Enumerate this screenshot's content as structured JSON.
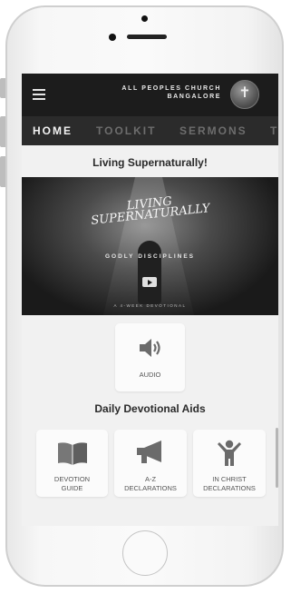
{
  "app": {
    "brand_line1": "ALL PEOPLES CHURCH",
    "brand_line2": "BANGALORE",
    "logo_label": "APC logo"
  },
  "tabs": [
    {
      "label": "HOME",
      "active": true
    },
    {
      "label": "TOOLKIT",
      "active": false
    },
    {
      "label": "SERMONS",
      "active": false
    },
    {
      "label": "T",
      "active": false
    }
  ],
  "home": {
    "title": "Living Supernaturally!",
    "hero": {
      "script_line1": "LIVING",
      "script_line2": "SUPERNATURALLY",
      "subtitle": "GODLY DISCIPLINES",
      "small_text": "A 4-WEEK DEVOTIONAL"
    },
    "audio_tile": {
      "label": "AUDIO",
      "icon": "speaker-icon"
    },
    "aids_title": "Daily Devotional Aids",
    "aids": [
      {
        "line1": "DEVOTION",
        "line2": "GUIDE",
        "icon": "open-book-icon"
      },
      {
        "line1": "A-Z",
        "line2": "DECLARATIONS",
        "icon": "megaphone-icon"
      },
      {
        "line1": "IN CHRIST",
        "line2": "DECLARATIONS",
        "icon": "person-raised-arms-icon"
      }
    ]
  },
  "colors": {
    "topbar": "#1c1c1c",
    "tabbar": "#2b2b2b",
    "tab_active": "#f2f2f2",
    "tab_inactive": "#6d6d6d",
    "background": "#f1f1f1"
  }
}
